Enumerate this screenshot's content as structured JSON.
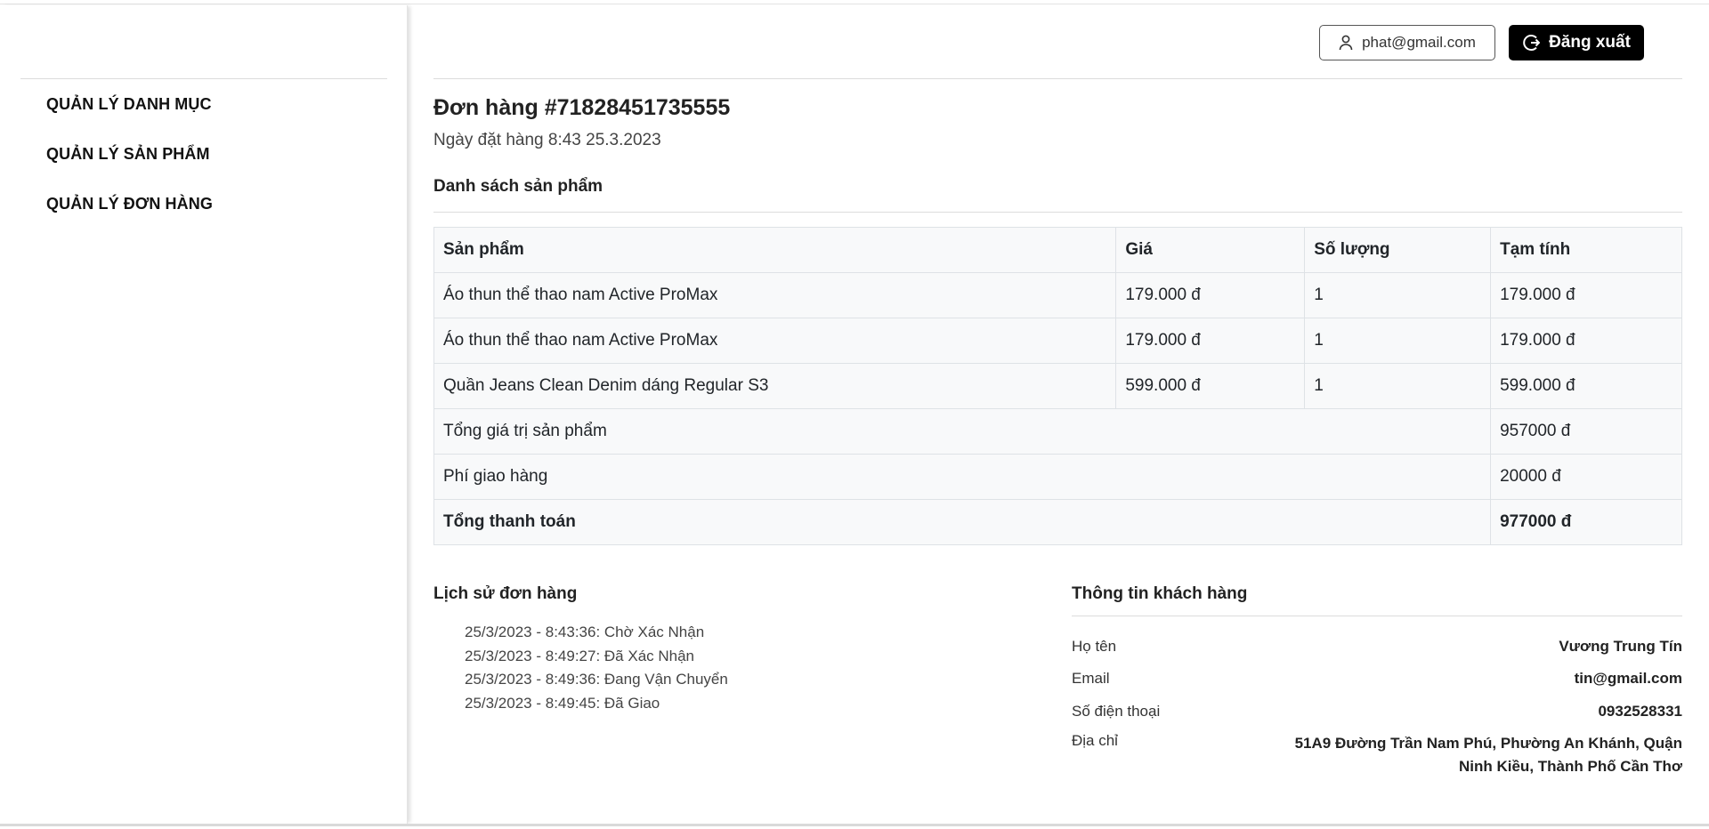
{
  "sidebar": {
    "items": [
      {
        "label": "QUẢN LÝ DANH MỤC"
      },
      {
        "label": "QUẢN LÝ SẢN PHẨM"
      },
      {
        "label": "QUẢN LÝ ĐƠN HÀNG"
      }
    ]
  },
  "header": {
    "user_email": "phat@gmail.com",
    "logout_label": "Đăng xuất"
  },
  "order": {
    "title": "Đơn hàng #71828451735555",
    "date": "Ngày đặt hàng 8:43 25.3.2023"
  },
  "products": {
    "section_title": "Danh sách sản phẩm",
    "columns": [
      "Sản phẩm",
      "Giá",
      "Số lượng",
      "Tạm tính"
    ],
    "rows": [
      {
        "name": "Áo thun thể thao nam Active ProMax",
        "price": "179.000 đ",
        "qty": "1",
        "subtotal": "179.000 đ"
      },
      {
        "name": "Áo thun thể thao nam Active ProMax",
        "price": "179.000 đ",
        "qty": "1",
        "subtotal": "179.000 đ"
      },
      {
        "name": "Quần Jeans Clean Denim dáng Regular S3",
        "price": "599.000 đ",
        "qty": "1",
        "subtotal": "599.000 đ"
      }
    ],
    "summary": {
      "total_products_label": "Tổng giá trị sản phẩm",
      "total_products_value": "957000 đ",
      "shipping_label": "Phí giao hàng",
      "shipping_value": "20000 đ",
      "grand_total_label": "Tổng thanh toán",
      "grand_total_value": "977000 đ"
    }
  },
  "history": {
    "title": "Lịch sử đơn hàng",
    "entries": [
      "25/3/2023 - 8:43:36: Chờ Xác Nhận",
      "25/3/2023 - 8:49:27: Đã Xác Nhận",
      "25/3/2023 - 8:49:36: Đang Vận Chuyển",
      "25/3/2023 - 8:49:45: Đã Giao"
    ]
  },
  "customer": {
    "title": "Thông tin khách hàng",
    "name_label": "Họ tên",
    "name_value": "Vương Trung Tín",
    "email_label": "Email",
    "email_value": "tin@gmail.com",
    "phone_label": "Số điện thoại",
    "phone_value": "0932528331",
    "address_label": "Địa chỉ",
    "address_value": "51A9 Đường Trần Nam Phú, Phường An Khánh, Quận Ninh Kiều, Thành Phố Cần Thơ"
  },
  "icons": {
    "user": "user-icon",
    "logout": "logout-icon"
  }
}
